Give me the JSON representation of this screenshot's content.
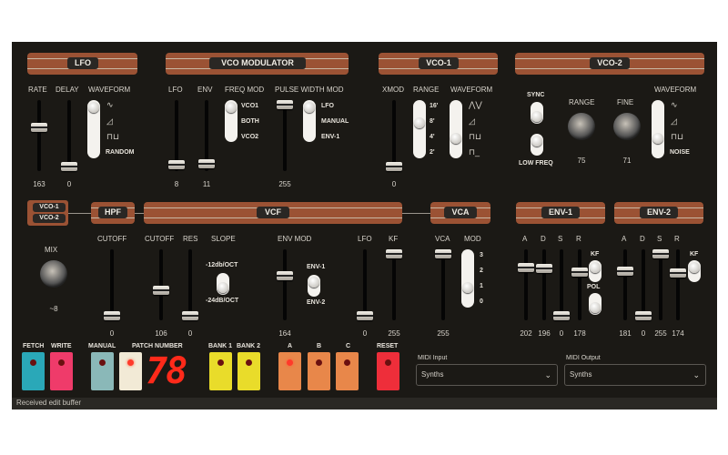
{
  "sections": {
    "lfo": "LFO",
    "vco_mod": "VCO MODULATOR",
    "vco1": "VCO-1",
    "vco2": "VCO-2",
    "vco1_small": "VCO-1",
    "vco2_small": "VCO-2",
    "hpf": "HPF",
    "vcf": "VCF",
    "vca": "VCA",
    "env1": "ENV-1",
    "env2": "ENV-2"
  },
  "lfo": {
    "rate": "RATE",
    "delay": "DELAY",
    "waveform": "WAVEFORM",
    "random": "RANDOM",
    "rate_val": "163",
    "delay_val": "0"
  },
  "vcomod": {
    "lfo": "LFO",
    "env": "ENV",
    "freqmod": "FREQ MOD",
    "pwm": "PULSE WIDTH MOD",
    "fm_opts": [
      "VCO1",
      "BOTH",
      "VCO2"
    ],
    "pw_opts": [
      "LFO",
      "MANUAL",
      "ENV-1"
    ],
    "lfo_val": "8",
    "env_val": "11",
    "pwm_val": "255"
  },
  "vco1": {
    "xmod": "XMOD",
    "range": "RANGE",
    "waveform": "WAVEFORM",
    "ranges": [
      "16'",
      "8'",
      "4'",
      "2'"
    ],
    "xmod_val": "0"
  },
  "vco2": {
    "sync": "SYNC",
    "lowfreq": "LOW FREQ",
    "range": "RANGE",
    "fine": "FINE",
    "waveform": "WAVEFORM",
    "noise": "NOISE",
    "range_val": "75",
    "fine_val": "71"
  },
  "mix": {
    "label": "MIX",
    "value": "~8"
  },
  "hpf": {
    "cutoff": "CUTOFF",
    "cutoff_val": "0"
  },
  "vcf": {
    "cutoff": "CUTOFF",
    "res": "RES",
    "slope": "SLOPE",
    "envmod": "ENV MOD",
    "lfo": "LFO",
    "kf": "KF",
    "slope12": "-12db/OCT",
    "slope24": "-24dB/OCT",
    "env1": "ENV-1",
    "env2": "ENV-2",
    "cutoff_val": "106",
    "res_val": "0",
    "envmod_val": "164",
    "lfo_val": "0",
    "kf_val": "255"
  },
  "vca": {
    "vca": "VCA",
    "mod": "MOD",
    "mods": [
      "3",
      "2",
      "1",
      "0"
    ],
    "vca_val": "255"
  },
  "env1": {
    "a": "A",
    "d": "D",
    "s": "S",
    "r": "R",
    "kf": "KF",
    "pol": "POL",
    "vals": [
      "202",
      "196",
      "0",
      "178"
    ]
  },
  "env2": {
    "a": "A",
    "d": "D",
    "s": "S",
    "r": "R",
    "kf": "KF",
    "vals": [
      "181",
      "0",
      "255",
      "174"
    ]
  },
  "bottom": {
    "fetch": "FETCH",
    "write": "WRITE",
    "manual": "MANUAL",
    "patch": "PATCH NUMBER",
    "patch_num": "78",
    "bank1": "BANK 1",
    "bank2": "BANK 2",
    "a": "A",
    "b": "B",
    "c": "C",
    "reset": "RESET"
  },
  "midi": {
    "in_label": "MIDI Input",
    "in_val": "Synths",
    "out_label": "MIDI Output",
    "out_val": "Synths"
  },
  "status": "Received edit buffer",
  "colors": {
    "panel": "#1b1915",
    "header": "#9b5234",
    "fetch": "#2aa8b8",
    "write": "#ef3b6a",
    "manual": "#8ab8b8",
    "yellow": "#e9dc2a",
    "orange": "#e8874a",
    "reset": "#ee2e3a",
    "led_digits": "#ff2a1a"
  }
}
